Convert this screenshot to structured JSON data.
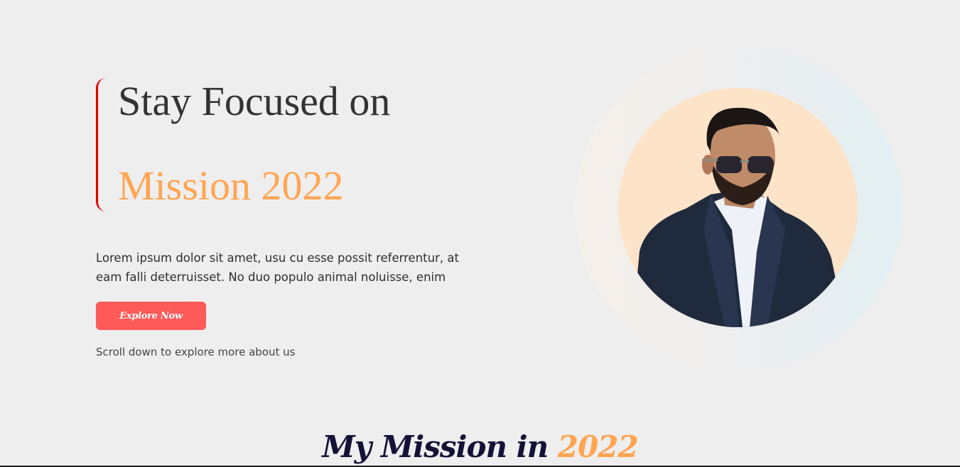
{
  "hero": {
    "heading_line1": "Stay Focused on",
    "heading_line2": "Mission 2022",
    "paragraph": "Lorem ipsum dolor sit amet, usu cu esse possit referrentur, at eam falli deterruisset. No duo populo animal noluisse, enim",
    "button_label": "Explore Now",
    "scroll_hint": "Scroll down to explore more about us"
  },
  "section": {
    "title_main": "My Mission in ",
    "title_accent": "2022"
  },
  "colors": {
    "background": "#eeeeee",
    "accent_orange": "#ffa552",
    "button_red": "#ff5a5a",
    "bracket_red": "#e60000",
    "title_navy": "#141238",
    "portrait_bg": "#fde3c8"
  },
  "images": {
    "portrait": "portrait-of-man-in-suit-and-sunglasses"
  }
}
